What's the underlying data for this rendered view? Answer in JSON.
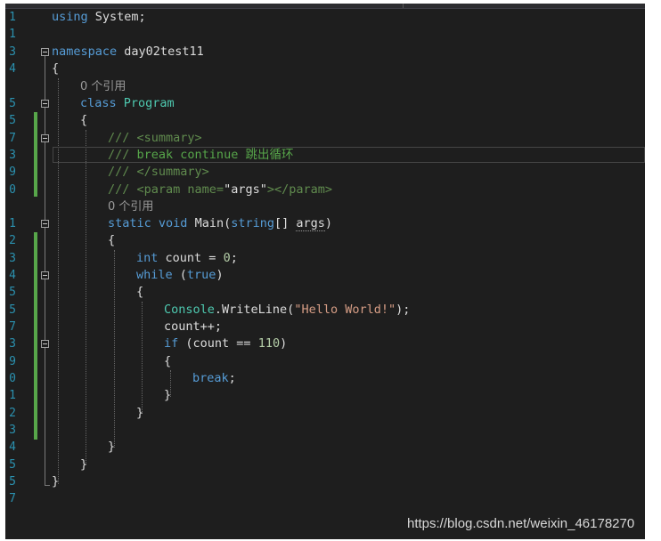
{
  "editor": {
    "line_numbers": [
      "1",
      "1",
      "3",
      "4",
      "5",
      "5",
      "7",
      "3",
      "9",
      "0",
      "1",
      "2",
      "3",
      "4",
      "5",
      "5",
      "7",
      "3",
      "9",
      "0",
      "1",
      "2",
      "3",
      "4",
      "5",
      "5",
      "7"
    ],
    "lines": {
      "using_kw": "using",
      "using_ns": "System;",
      "ns_kw": "namespace",
      "ns_name": "day02test11",
      "brace_open": "{",
      "brace_close": "}",
      "codelens_1": "0 个引用",
      "class_kw": "class",
      "class_name": "Program",
      "doc_slashes": "///",
      "doc_summary_open": "<summary>",
      "doc_text": "break continue 跳出循环",
      "doc_summary_close": "</summary>",
      "doc_param_open": "<param name=",
      "doc_param_val": "\"args\"",
      "doc_param_close": "></param>",
      "codelens_2": "0 个引用",
      "static_kw": "static",
      "void_kw": "void",
      "main_name": "Main(",
      "string_kw": "string",
      "main_rest": "[] ",
      "args_name": "args",
      "close_paren": ")",
      "int_kw": "int",
      "count_decl": "count = ",
      "zero": "0",
      "semicolon": ";",
      "while_kw": "while",
      "paren_open": "(",
      "true_kw": "true",
      "paren_close": ")",
      "console_type": "Console",
      "writeline": ".WriteLine(",
      "hello_str": "\"Hello World!\"",
      "writeline_end": ");",
      "count_inc": "count++;",
      "if_kw": "if",
      "if_cond": "(count == ",
      "num_110": "110",
      "if_end": ")",
      "break_kw": "break",
      "break_end": ";"
    }
  },
  "topbar": {
    "partial_text": ""
  },
  "watermark": "https://blog.csdn.net/weixin_46178270"
}
